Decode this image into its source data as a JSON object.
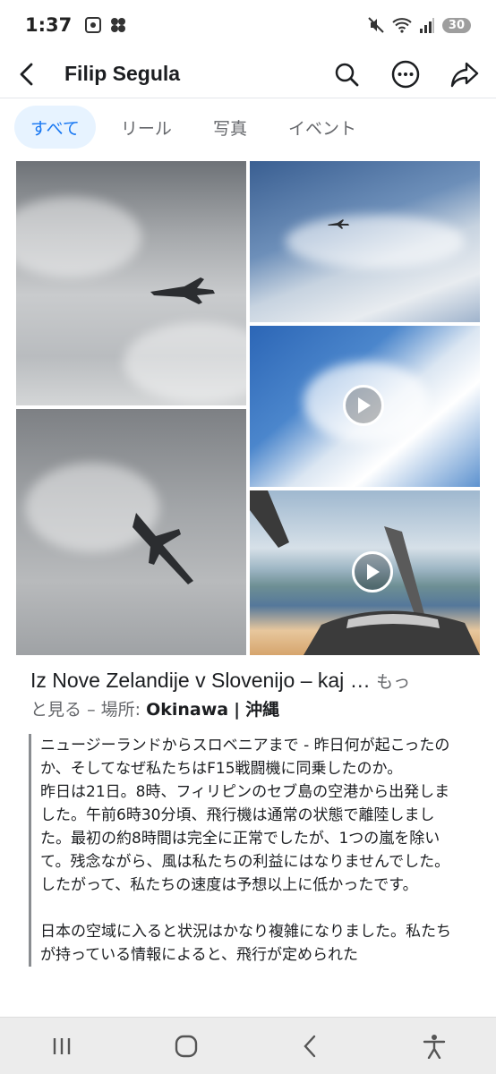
{
  "status": {
    "time": "1:37",
    "battery": "30"
  },
  "header": {
    "title": "Filip Segula"
  },
  "tabs": [
    {
      "label": "すべて",
      "active": true
    },
    {
      "label": "リール",
      "active": false
    },
    {
      "label": "写真",
      "active": false
    },
    {
      "label": "イベント",
      "active": false
    }
  ],
  "post": {
    "title": "Iz Nove Zelandije v Slovenijo – kaj",
    "ellipsis": "…",
    "more_label": "もっと見る",
    "more_part1": "もっ",
    "more_part2": "と見る",
    "location_prefix": "– 場所:",
    "location_name": "Okinawa",
    "location_sep": "|",
    "location_region": "沖縄",
    "paragraphs": [
      "ニュージーランドからスロベニアまで - 昨日何が起こったのか、そしてなぜ私たちはF15戦闘機に同乗したのか。",
      "昨日は21日。8時、フィリピンのセブ島の空港から出発しました。午前6時30分頃、飛行機は通常の状態で離陸しました。最初の約8時間は完全に正常でしたが、1つの嵐を除いて。残念ながら、風は私たちの利益にはなりませんでした。したがって、私たちの速度は予想以上に低かったです。",
      "日本の空域に入ると状況はかなり複雑になりました。私たちが持っている情報によると、飛行が定められた"
    ]
  },
  "icons": {
    "back": "back-arrow-icon",
    "search": "search-icon",
    "more": "more-options-icon",
    "share": "share-icon",
    "play": "play-icon"
  },
  "colors": {
    "accent": "#1877f2",
    "tab_active_bg": "#e7f3ff"
  }
}
